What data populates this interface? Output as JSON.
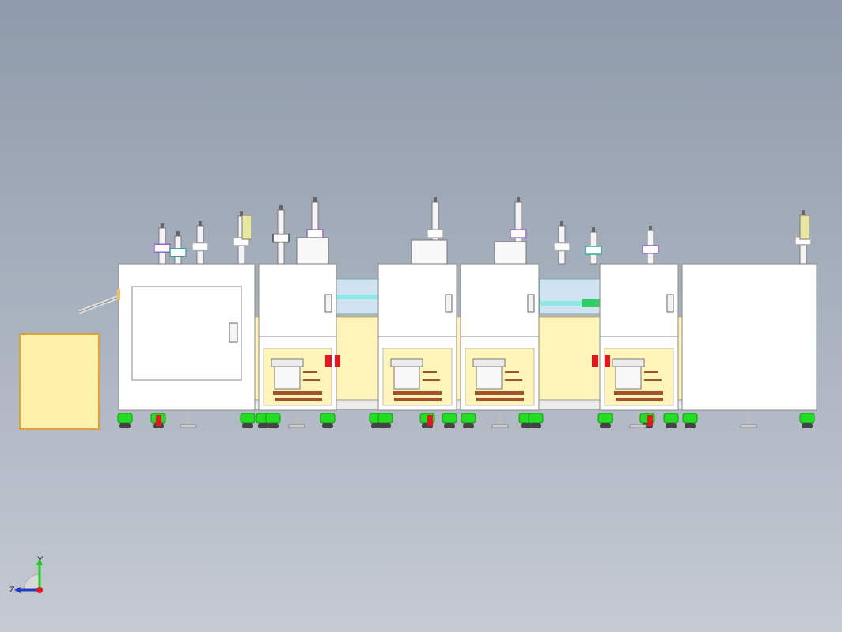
{
  "viewport": {
    "background_top": "#8f9aaa",
    "background_bottom": "#c5cad3"
  },
  "colors": {
    "cabinet": "#ffffff",
    "cabinet_edge": "#8a8a8a",
    "panel_yellow": "#fff5b8",
    "box_yellow": "#fff2a8",
    "box_edge": "#e0a040",
    "caster_green": "#22dd22",
    "accent_red": "#e8141e",
    "accent_blue": "#1e3cc8",
    "rail_cyan": "#8fe8e8",
    "feeder_brown": "#a0522d"
  },
  "axis_triad": {
    "y_label": "Y",
    "z_label": "Z",
    "x_color": "#e8141e",
    "y_color": "#22cc22",
    "z_color": "#1e3cc8"
  },
  "model": {
    "name": "assembly-line-front-view",
    "stations": [
      {
        "id": "unload-cabinet",
        "type": "large-cabinet"
      },
      {
        "id": "station-1",
        "type": "feeder-station"
      },
      {
        "id": "station-2",
        "type": "feeder-station"
      },
      {
        "id": "station-3",
        "type": "feeder-station"
      },
      {
        "id": "station-4",
        "type": "feeder-station"
      },
      {
        "id": "end-cabinet",
        "type": "large-cabinet"
      }
    ]
  }
}
